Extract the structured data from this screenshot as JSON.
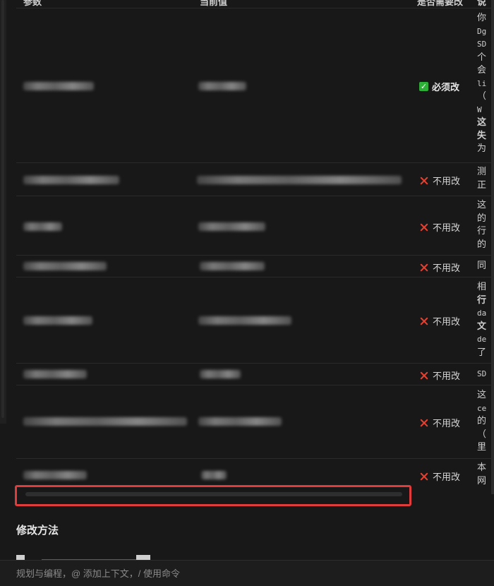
{
  "table": {
    "headers": {
      "param": "参数",
      "current": "当前值",
      "need_change": "是否需要改",
      "note": "说"
    },
    "rows": [
      {
        "status": "必须改",
        "status_type": "must",
        "desc": [
          "你",
          "Dg",
          "SD",
          "个",
          "会",
          "li",
          "（",
          "W",
          "这",
          "失",
          "为"
        ]
      },
      {
        "status": "不用改",
        "status_type": "no",
        "desc": [
          "测",
          "正"
        ]
      },
      {
        "status": "不用改",
        "status_type": "no",
        "desc": [
          "这",
          "的",
          "行",
          "的"
        ]
      },
      {
        "status": "不用改",
        "status_type": "no",
        "desc": [
          "同"
        ]
      },
      {
        "status": "不用改",
        "status_type": "no",
        "desc": [
          "相",
          "行",
          "da",
          "文",
          "de",
          "了"
        ]
      },
      {
        "status": "不用改",
        "status_type": "no",
        "desc": [
          "SD"
        ]
      },
      {
        "status": "不用改",
        "status_type": "no",
        "desc": [
          "这",
          "ce",
          "的",
          "（",
          "里"
        ]
      },
      {
        "status": "不用改",
        "status_type": "no",
        "desc": [
          "本",
          "网"
        ]
      }
    ]
  },
  "section": {
    "heading": "修改方法"
  },
  "input": {
    "placeholder": "规划与编程，@ 添加上下文，/ 使用命令"
  },
  "colors": {
    "background": "#181818",
    "check_green": "#2db036",
    "cross_red": "#e8402f",
    "highlight_red": "#e03c3c"
  }
}
